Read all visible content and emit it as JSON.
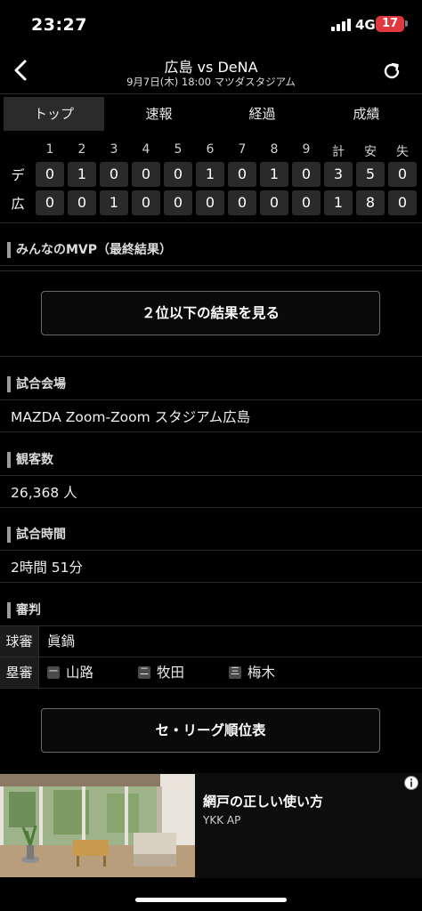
{
  "status_bar": {
    "time": "23:27",
    "network": "4G",
    "battery": "17"
  },
  "header": {
    "title": "広島 vs DeNA",
    "subtitle": "9月7日(木) 18:00 マツダスタジアム"
  },
  "tabs": [
    {
      "label": "トップ",
      "active": true
    },
    {
      "label": "速報",
      "active": false
    },
    {
      "label": "経過",
      "active": false
    },
    {
      "label": "成績",
      "active": false
    }
  ],
  "scoreboard": {
    "headers": [
      "1",
      "2",
      "3",
      "4",
      "5",
      "6",
      "7",
      "8",
      "9",
      "計",
      "安",
      "失"
    ],
    "teams": [
      {
        "name": "デ",
        "scores": [
          "0",
          "1",
          "0",
          "0",
          "0",
          "1",
          "0",
          "1",
          "0",
          "3",
          "5",
          "0"
        ]
      },
      {
        "name": "広",
        "scores": [
          "0",
          "0",
          "1",
          "0",
          "0",
          "0",
          "0",
          "0",
          "0",
          "1",
          "8",
          "0"
        ]
      }
    ]
  },
  "mvp": {
    "heading": "みんなのMVP（最終結果）",
    "button": "２位以下の結果を見る"
  },
  "venue": {
    "heading": "試合会場",
    "value": "MAZDA Zoom-Zoom スタジアム広島"
  },
  "attendance": {
    "heading": "観客数",
    "value": "26,368 人"
  },
  "duration": {
    "heading": "試合時間",
    "value": "2時間 51分"
  },
  "umpires": {
    "heading": "審判",
    "plate_label": "球審",
    "plate_name": "眞鍋",
    "base_label": "塁審",
    "bases": [
      {
        "badge": "一",
        "name": "山路"
      },
      {
        "badge": "二",
        "name": "牧田"
      },
      {
        "badge": "三",
        "name": "梅木"
      }
    ]
  },
  "standings_button": "セ・リーグ順位表",
  "ad": {
    "title": "網戸の正しい使い方",
    "sponsor": "YKK AP"
  },
  "icons": {
    "back": "chevron-left-icon",
    "refresh": "refresh-icon",
    "ad_info": "info-icon"
  },
  "colors": {
    "background": "#000000",
    "cell": "#2a2a2a",
    "battery": "#e0383e",
    "divider": "#2a2a2a"
  }
}
